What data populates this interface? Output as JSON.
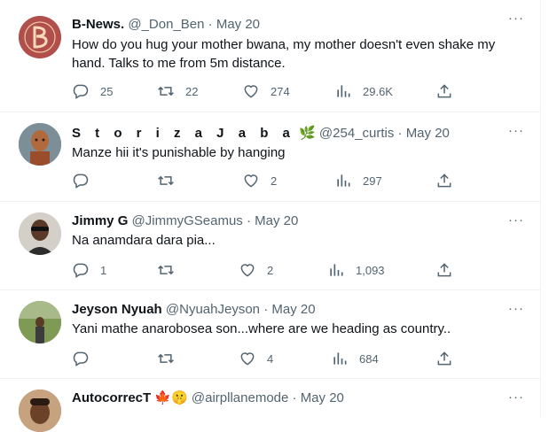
{
  "tweets": [
    {
      "name": "B-News.",
      "handle": "@_Don_Ben",
      "date": "May 20",
      "text": "How do you hug your mother bwana, my mother doesn't even shake my hand. Talks to me from 5m distance.",
      "replies": "25",
      "retweets": "22",
      "likes": "274",
      "views": "29.6K"
    },
    {
      "name": "S t o r i z a  J a b a",
      "name_emoji": "🌿",
      "handle": "@254_curtis",
      "date": "May 20",
      "text": "Manze hii it's punishable by hanging",
      "replies": "",
      "retweets": "",
      "likes": "2",
      "views": "297"
    },
    {
      "name": "Jimmy G",
      "handle": "@JimmyGSeamus",
      "date": "May 20",
      "text": "Na anamdara dara pia...",
      "replies": "1",
      "retweets": "",
      "likes": "2",
      "views": "1,093"
    },
    {
      "name": "Jeyson Nyuah",
      "handle": "@NyuahJeyson",
      "date": "May 20",
      "text": "Yani mathe anarobosea son...where are we heading as country..",
      "replies": "",
      "retweets": "",
      "likes": "4",
      "views": "684"
    },
    {
      "name": "AutocorrecT",
      "name_emoji": "🍁🤫",
      "handle": "@airpllanemode",
      "date": "May 20"
    }
  ],
  "more_label": "···",
  "separator": "·",
  "colors": {
    "text": "#0f1419",
    "muted": "#536471",
    "border": "#eff3f4"
  }
}
